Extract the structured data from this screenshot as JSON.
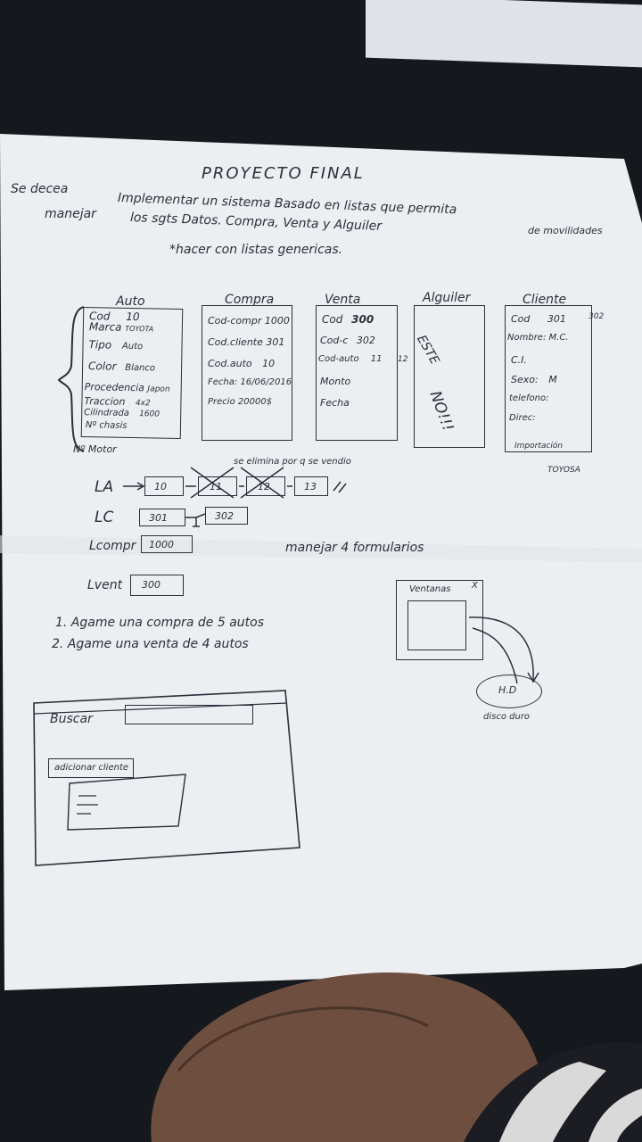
{
  "title": "PROYECTO FINAL",
  "intro": {
    "line1_left": "Se decea",
    "line1_right": "Implementar un sistema Basado en listas que permita",
    "line2_left": "manejar",
    "line2_right": "los sgts Datos. Compra, Venta y Alguiler",
    "line2_tail": "de movilidades",
    "note": "*hacer con listas genericas."
  },
  "forms": {
    "auto": {
      "title": "Auto",
      "fields": [
        {
          "label": "Cod",
          "value": "10"
        },
        {
          "label": "Marca",
          "value": "TOYOTA"
        },
        {
          "label": "Tipo",
          "value": "Auto"
        },
        {
          "label": "Color",
          "value": "Blanco"
        },
        {
          "label": "Procedencia",
          "value": "Japon"
        },
        {
          "label": "Traccion",
          "value": "4x2"
        },
        {
          "label": "Cilindrada",
          "value": "1600"
        },
        {
          "label": "Nº chasis",
          "value": ""
        }
      ],
      "extra": "Nº Motor"
    },
    "compra": {
      "title": "Compra",
      "fields": [
        {
          "label": "Cod-compr",
          "value": "1000"
        },
        {
          "label": "Cod.cliente",
          "value": "301"
        },
        {
          "label": "Cod.auto",
          "value": "10"
        },
        {
          "label": "Fecha:",
          "value": "16/06/2016"
        },
        {
          "label": "Precio",
          "value": "20000$"
        }
      ]
    },
    "venta": {
      "title": "Venta",
      "fields": [
        {
          "label": "Cod",
          "value": "300"
        },
        {
          "label": "Cod-c",
          "value": "302"
        },
        {
          "label": "Cod-auto",
          "value": "11"
        },
        {
          "label": "Monto",
          "value": ""
        },
        {
          "label": "Fecha",
          "value": ""
        }
      ],
      "side_number": "12"
    },
    "alquiler": {
      "title": "Alguiler",
      "text1": "ESTE",
      "text2": "NO!!!"
    },
    "cliente": {
      "title": "Cliente",
      "fields": [
        {
          "label": "Cod",
          "value": "301"
        },
        {
          "label": "Nombre:",
          "value": "M.C."
        },
        {
          "label": "C.I.",
          "value": ""
        },
        {
          "label": "Sexo:",
          "value": "M"
        },
        {
          "label": "telefono:",
          "value": ""
        },
        {
          "label": "Direc:",
          "value": ""
        }
      ],
      "side_number": "302",
      "footer1": "Importación",
      "footer2": "TOYOSA"
    }
  },
  "lists": {
    "note": "se elimina por q se vendio",
    "la": {
      "label": "LA",
      "nodes": [
        "10",
        "11",
        "12",
        "13"
      ]
    },
    "lc": {
      "label": "LC",
      "nodes": [
        "301",
        "302"
      ]
    },
    "lcompr": {
      "label": "Lcompr",
      "nodes": [
        "1000"
      ]
    },
    "lvent": {
      "label": "Lvent",
      "nodes": [
        "300"
      ]
    }
  },
  "manage": "manejar 4 formularios",
  "tasks": [
    "1. Agame una compra de 5 autos",
    "2. Agame una venta de 4 autos"
  ],
  "window_sketch": {
    "title": "Ventanas",
    "close": "X",
    "disk": "H.D",
    "disk_label": "disco duro"
  },
  "search_sketch": {
    "label": "Buscar",
    "button": "adicionar cliente"
  }
}
